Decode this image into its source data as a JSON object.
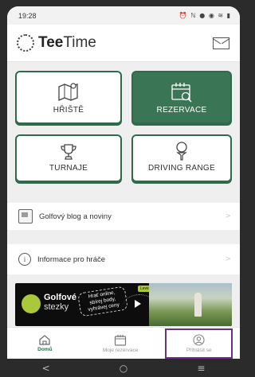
{
  "status_bar": {
    "time": "19:28",
    "icons": "⏰ ℕ ● ◉ ≋ ▮",
    "icon_names": [
      "alarm-icon",
      "nfc-icon",
      "location-icon",
      "vpn-icon",
      "wifi-icon",
      "signal-icon",
      "battery-icon"
    ]
  },
  "header": {
    "brand_bold": "Tee",
    "brand_light": "Time",
    "mail_icon": "envelope-icon"
  },
  "tiles": [
    {
      "label": "HŘIŠTĚ",
      "icon": "course-map-icon",
      "selected": false
    },
    {
      "label": "REZERVACE",
      "icon": "calendar-search-icon",
      "selected": true
    },
    {
      "label": "TURNAJE",
      "icon": "trophy-icon",
      "selected": false
    },
    {
      "label": "DRIVING RANGE",
      "icon": "golf-ball-tee-icon",
      "selected": false
    }
  ],
  "list": [
    {
      "label": "Golfový blog a noviny",
      "icon": "newspaper-icon"
    },
    {
      "label": "Informace pro hráče",
      "icon": "info-icon",
      "icon_glyph": "i"
    }
  ],
  "banner": {
    "title": "Golfové",
    "subtitle": "stezky",
    "tagline": "Hrať online, sbírej body, vyhrávej ceny",
    "badge": "Levicko"
  },
  "bottom_nav": [
    {
      "label": "Domů",
      "icon": "home-icon",
      "active": true
    },
    {
      "label": "Moje rezervace",
      "icon": "calendar-icon",
      "active": false
    },
    {
      "label": "Přihlásit se",
      "icon": "user-icon",
      "active": false
    }
  ],
  "system_nav": {
    "back": "<",
    "home": "○",
    "recents": "≡"
  },
  "colors": {
    "primary_green": "#2f6a4b",
    "highlight_border": "#6d2f82",
    "banner_accent": "#a9c93a"
  }
}
